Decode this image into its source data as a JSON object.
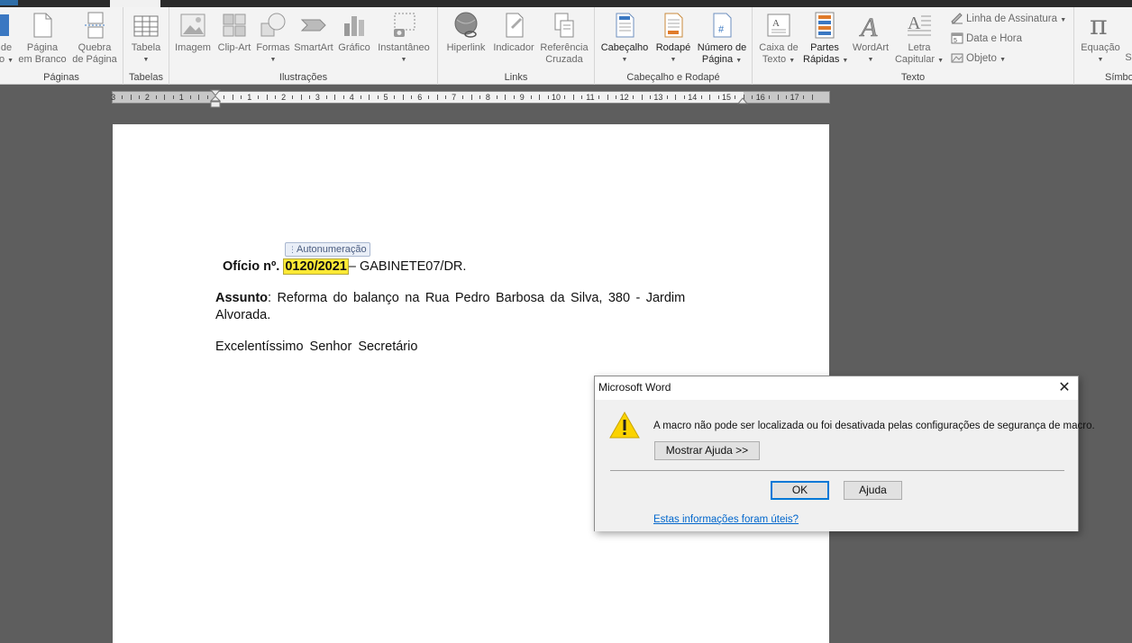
{
  "ribbon": {
    "pages_group": {
      "label": "Páginas",
      "items": [
        {
          "line1": "de",
          "line2": "o"
        },
        {
          "line1": "Página",
          "line2": "em Branco"
        },
        {
          "line1": "Quebra",
          "line2": "de Página"
        }
      ]
    },
    "tables_group": {
      "label": "Tabelas",
      "table": "Tabela"
    },
    "illustrations_group": {
      "label": "Ilustrações",
      "image": "Imagem",
      "clipart": "Clip-Art",
      "shapes": "Formas",
      "smartart": "SmartArt",
      "chart": "Gráfico",
      "screenshot": "Instantâneo"
    },
    "links_group": {
      "label": "Links",
      "hyperlink": "Hiperlink",
      "bookmark": "Indicador",
      "crossref_line1": "Referência",
      "crossref_line2": "Cruzada"
    },
    "header_footer_group": {
      "label": "Cabeçalho e Rodapé",
      "header": "Cabeçalho",
      "footer": "Rodapé",
      "page_number_line1": "Número de",
      "page_number_line2": "Página"
    },
    "text_group": {
      "label": "Texto",
      "textbox_line1": "Caixa de",
      "textbox_line2": "Texto",
      "quickparts_line1": "Partes",
      "quickparts_line2": "Rápidas",
      "wordart": "WordArt",
      "dropcap_line1": "Letra",
      "dropcap_line2": "Capitular",
      "signature_line": "Linha de Assinatura",
      "date_time": "Data e Hora",
      "object": "Objeto"
    },
    "symbols_group": {
      "label": "Símbol",
      "equation": "Equação",
      "symbol_partial": "S"
    }
  },
  "ruler": {
    "numbers": [
      "3",
      "2",
      "1",
      "1",
      "1",
      "2",
      "3",
      "4",
      "5",
      "6",
      "7",
      "8",
      "9",
      "10",
      "11",
      "12",
      "13",
      "14",
      "15",
      "16",
      "17"
    ]
  },
  "document": {
    "autonumber_tag": "Autonumeração",
    "oficio_label": "Ofício nº.",
    "oficio_number": "0120/2021",
    "oficio_suffix": "– GABINETE07/DR.",
    "assunto_label": "Assunto",
    "assunto_text_line1": ": Reforma do balanço na Rua Pedro Barbosa da Silva, 380 - Jardim",
    "assunto_text_line2": "Alvorada.",
    "salutation": "Excelentíssimo Senhor Secretário"
  },
  "dialog": {
    "title": "Microsoft Word",
    "close_glyph": "✕",
    "message": "A macro não pode ser localizada ou foi desativada pelas configurações de segurança de macro.",
    "show_help_button": "Mostrar Ajuda >>",
    "ok_button": "OK",
    "help_button": "Ajuda",
    "feedback_link": "Estas informações foram úteis?"
  },
  "colors": {
    "field_highlight": "#fde935",
    "default_button_border": "#0078d7",
    "link": "#0066cc",
    "workspace_bg": "#5e5e5e"
  }
}
